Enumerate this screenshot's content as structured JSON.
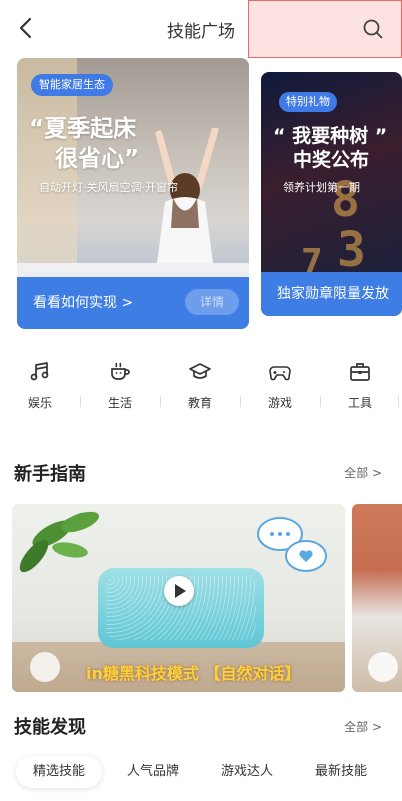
{
  "header": {
    "title": "技能广场"
  },
  "banners": [
    {
      "badge": "智能家居生态",
      "headline_line1": "“夏季起床",
      "headline_line2": "很省心”",
      "subline": "自动开灯·关风扇空调·开窗帘",
      "cta": "看看如何实现 >",
      "details": "详情"
    },
    {
      "badge": "特别礼物",
      "headline_line1": "“ 我要种树 ”",
      "headline_line2": "中奖公布",
      "subline": "领养计划第一期",
      "cta": "独家勋章限量发放"
    }
  ],
  "categories": [
    {
      "label": "娱乐",
      "icon": "music-note-icon"
    },
    {
      "label": "生活",
      "icon": "coffee-cup-icon"
    },
    {
      "label": "教育",
      "icon": "graduation-cap-icon"
    },
    {
      "label": "游戏",
      "icon": "gamepad-icon"
    },
    {
      "label": "工具",
      "icon": "toolbox-icon"
    }
  ],
  "guide": {
    "title": "新手指南",
    "more": "全部 >",
    "video_caption": "in糖黑科技模式 【自然对话】"
  },
  "discover": {
    "title": "技能发现",
    "more": "全部 >",
    "tabs": [
      "精选技能",
      "人气品牌",
      "游戏达人",
      "最新技能"
    ],
    "active_tab": "精选技能"
  },
  "colors": {
    "accent": "#3d7de4",
    "search_highlight": "#fde2e2",
    "caption_yellow": "#ffcf3a"
  }
}
